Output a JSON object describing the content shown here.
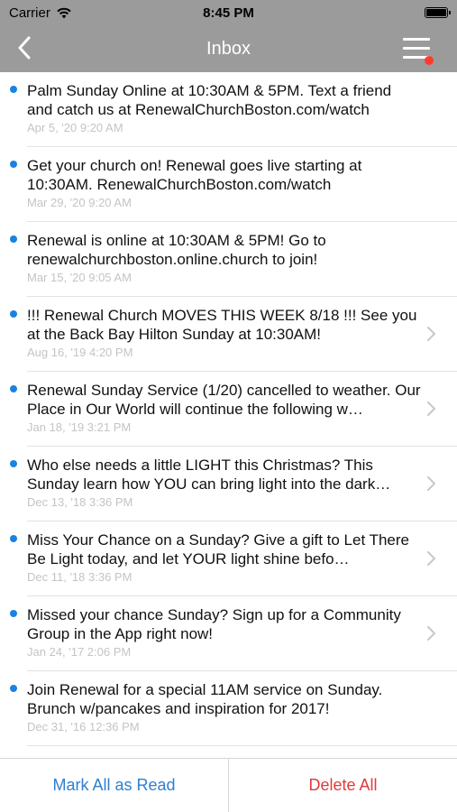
{
  "status": {
    "carrier": "Carrier",
    "time": "8:45 PM"
  },
  "nav": {
    "title": "Inbox"
  },
  "messages": [
    {
      "text": "Palm Sunday Online at 10:30AM & 5PM. Text a friend and catch us at RenewalChurchBoston.com/watch",
      "date": "Apr 5, '20 9:20 AM",
      "chevron": false
    },
    {
      "text": "Get your church on! Renewal goes live starting at 10:30AM. RenewalChurchBoston.com/watch",
      "date": "Mar 29, '20 9:20 AM",
      "chevron": false
    },
    {
      "text": "Renewal is online at 10:30AM & 5PM! Go to renewalchurchboston.online.church to join!",
      "date": "Mar 15, '20 9:05 AM",
      "chevron": false
    },
    {
      "text": "!!! Renewal Church MOVES THIS WEEK 8/18 !!! See you at the Back Bay Hilton Sunday at 10:30AM!",
      "date": "Aug 16, '19 4:20 PM",
      "chevron": true
    },
    {
      "text": "Renewal Sunday Service (1/20) cancelled to weather. Our Place in Our World will continue the following w…",
      "date": "Jan 18, '19 3:21 PM",
      "chevron": true
    },
    {
      "text": "Who else needs a little LIGHT this Christmas? This Sunday learn how YOU can bring light into the dark…",
      "date": "Dec 13, '18 3:36 PM",
      "chevron": true
    },
    {
      "text": "Miss Your Chance on a Sunday? Give a gift to Let There Be Light today, and let YOUR light shine befo…",
      "date": "Dec 11, '18 3:36 PM",
      "chevron": true
    },
    {
      "text": "Missed your chance Sunday? Sign up for a Community Group in the App right now!",
      "date": "Jan 24, '17 2:06 PM",
      "chevron": true
    },
    {
      "text": "Join Renewal for a special 11AM service on Sunday. Brunch w/pancakes and inspiration for 2017!",
      "date": "Dec 31, '16 12:36 PM",
      "chevron": false
    }
  ],
  "footer": {
    "mark_all_read": "Mark All as Read",
    "delete_all": "Delete All"
  },
  "colors": {
    "nav_bg": "#9b9b9b",
    "unread_dot": "#1a82e2",
    "menu_badge": "#ff3b30",
    "mark_read": "#2f7fd1",
    "delete": "#e23a3a"
  }
}
